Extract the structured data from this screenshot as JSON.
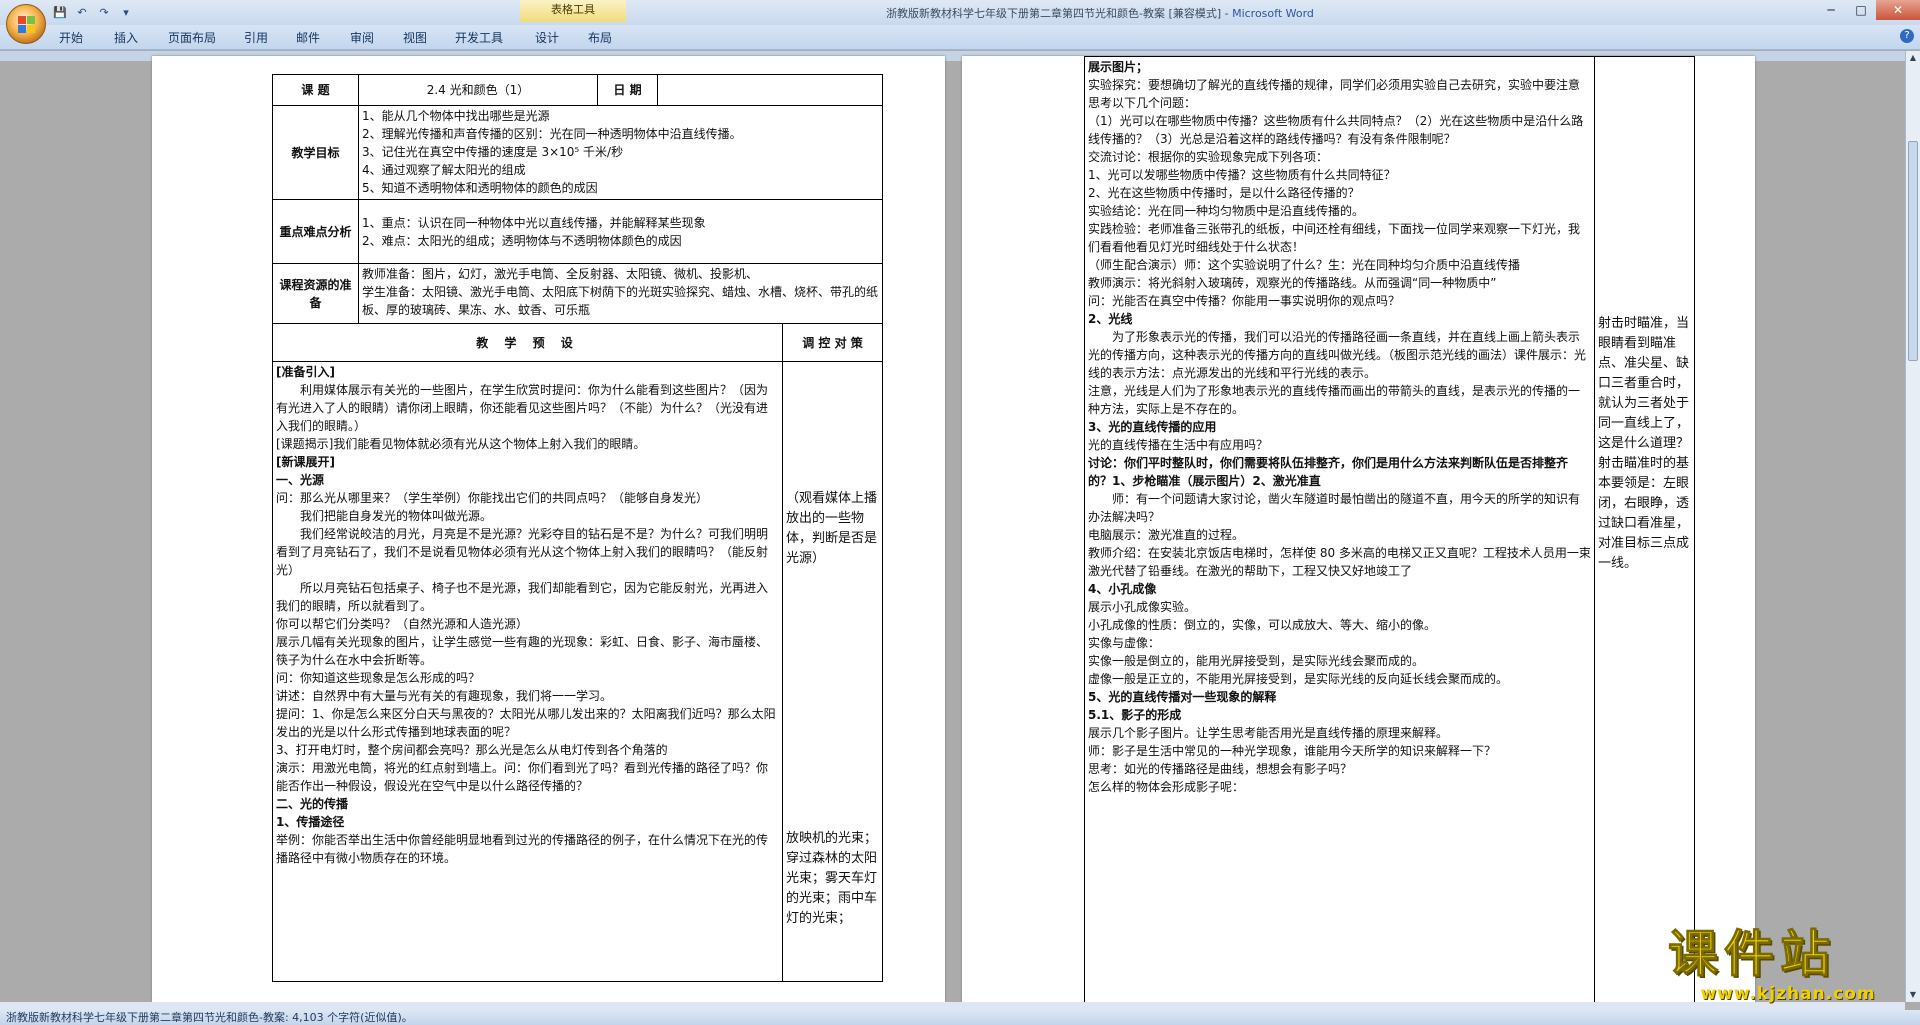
{
  "window": {
    "title_prefix": "浙教版新教材科学七年级下册第二章第四节光和颜色-教案 [兼容模式] - ",
    "app_name": "Microsoft Word",
    "table_tools": "表格工具"
  },
  "ribbon": {
    "tabs": [
      "开始",
      "插入",
      "页面布局",
      "引用",
      "邮件",
      "审阅",
      "视图",
      "开发工具",
      "设计",
      "布局"
    ]
  },
  "status": {
    "text": "浙教版新教材科学七年级下册第二章第四节光和颜色-教案: 4,103 个字符(近似值)。"
  },
  "watermark": {
    "text": "课件站",
    "url": "www.kjzhan.com"
  },
  "page1": {
    "topic_label": "课  题",
    "topic_value": "2.4 光和颜色（1）",
    "date_label": "日  期",
    "goals_label": "教学目标",
    "goals": [
      "1、能从几个物体中找出哪些是光源",
      "2、理解光传播和声音传播的区别：光在同一种透明物体中沿直线传播。",
      "3、记住光在真空中传播的速度是 3×10⁵ 千米/秒",
      "4、通过观察了解太阳光的组成",
      "5、知道不透明物体和透明物体的颜色的成因"
    ],
    "key_label": "重点难点分析",
    "key": [
      "1、重点：认识在同一种物体中光以直线传播，并能解释某些现象",
      "2、难点：太阳光的组成；透明物体与不透明物体颜色的成因"
    ],
    "res_label": "课程资源的准备",
    "res": [
      "教师准备：图片，幻灯，激光手电筒、全反射器、太阳镜、微机、投影机、",
      "学生准备：太阳镜、激光手电筒、太阳底下树荫下的光斑实验探究、蜡烛、水槽、烧杯、带孔的纸板、厚的玻璃砖、果冻、水、蚊香、可乐瓶"
    ],
    "plan_header": "教  学  预  设",
    "ctrl_header": "调 控 对 策",
    "body": [
      {
        "t": "[准备引入]",
        "b": true
      },
      {
        "t": "利用媒体展示有关光的一些图片，在学生欣赏时提问：你为什么能看到这些图片？（因为有光进入了人的眼睛）请你闭上眼睛，你还能看见这些图片吗？（不能）为什么？（光没有进入我们的眼睛。）",
        "i": true
      },
      {
        "t": " [课题揭示]我们能看见物体就必须有光从这个物体上射入我们的眼睛。"
      },
      {
        "t": " [新课展开]",
        "b": true
      },
      {
        "t": "一、光源",
        "b": true
      },
      {
        "t": "问：那么光从哪里来？（学生举例）你能找出它们的共同点吗？（能够自身发光）"
      },
      {
        "t": "我们把能自身发光的物体叫做光源。",
        "i": true
      },
      {
        "t": "我们经常说皎洁的月光，月亮是不是光源？光彩夺目的钻石是不是？为什么？可我们明明看到了月亮钻石了，我们不是说看见物体必须有光从这个物体上射入我们的眼睛吗？（能反射光）",
        "i": true
      },
      {
        "t": "所以月亮钻石包括桌子、椅子也不是光源，我们却能看到它，因为它能反射光，光再进入我们的眼睛，所以就看到了。",
        "i": true
      },
      {
        "t": "你可以帮它们分类吗？（自然光源和人造光源）"
      },
      {
        "t": "展示几幅有关光现象的图片，让学生感觉一些有趣的光现象：彩虹、日食、影子、海市蜃楼、筷子为什么在水中会折断等。"
      },
      {
        "t": "问：你知道这些现象是怎么形成的吗？"
      },
      {
        "t": "讲述：自然界中有大量与光有关的有趣现象，我们将一一学习。"
      },
      {
        "t": "提问：1、你是怎么来区分白天与黑夜的？太阳光从哪儿发出来的？太阳离我们近吗？那么太阳发出的光是以什么形式传播到地球表面的呢？"
      },
      {
        "t": "3、打开电灯时，整个房间都会亮吗？那么光是怎么从电灯传到各个角落的"
      },
      {
        "t": "演示：用激光电筒，将光的红点射到墙上。问：你们看到光了吗？看到光传播的路径了吗？你能否作出一种假设，假设光在空气中是以什么路径传播的？"
      },
      {
        "t": "二、光的传播",
        "b": true
      },
      {
        "t": "1、传播途径",
        "b": true
      },
      {
        "t": "举例：你能否举出生活中你曾经能明显地看到过光的传播路径的例子，在什么情况下在光的传播路径中有微小物质存在的环境。"
      }
    ],
    "ctrl_a": "（观看媒体上播放出的一些物体，判断是否是光源）",
    "ctrl_b": "放映机的光束；穿过森林的太阳光束；雾天车灯的光束；雨中车灯的光束；"
  },
  "page2": {
    "body": [
      {
        "t": "展示图片；",
        "b": true
      },
      {
        "t": "实验探究：要想确切了解光的直线传播的规律，同学们必须用实验自己去研究，实验中要注意思考以下几个问题："
      },
      {
        "t": "（1）光可以在哪些物质中传播？这些物质有什么共同特点？（2）光在这些物质中是沿什么路线传播的？（3）光总是沿着这样的路线传播吗？有没有条件限制呢？"
      },
      {
        "t": "交流讨论：根据你的实验现象完成下列各项："
      },
      {
        "t": "1、光可以发哪些物质中传播？这些物质有什么共同特征？"
      },
      {
        "t": "2、光在这些物质中传播时，是以什么路径传播的？"
      },
      {
        "t": "实验结论：光在同一种均匀物质中是沿直线传播的。"
      },
      {
        "t": "实践检验：老师准备三张带孔的纸板，中间还栓有细线，下面找一位同学来观察一下灯光，我们看看他看见灯光时细线处于什么状态！"
      },
      {
        "t": "（师生配合演示）师：这个实验说明了什么？生：光在同种均匀介质中沿直线传播"
      },
      {
        "t": "教师演示：将光斜射入玻璃砖，观察光的传播路线。从而强调“同一种物质中”"
      },
      {
        "t": "问：光能否在真空中传播？你能用一事实说明你的观点吗？"
      },
      {
        "t": "2、光线",
        "b": true
      },
      {
        "t": "为了形象表示光的传播，我们可以沿光的传播路径画一条直线，并在直线上画上箭头表示光的传播方向，这种表示光的传播方向的直线叫做光线。（板图示范光线的画法）课件展示：光线的表示方法：点光源发出的光线和平行光线的表示。",
        "i": true
      },
      {
        "t": "注意，光线是人们为了形象地表示光的直线传播而画出的带箭头的直线，是表示光的传播的一种方法，实际上是不存在的。"
      },
      {
        "t": "3、光的直线传播的应用",
        "b": true
      },
      {
        "t": "光的直线传播在生活中有应用吗？"
      },
      {
        "t": "讨论：你们平时整队时，你们需要将队伍排整齐，你们是用什么方法来判断队伍是否排整齐的？1、步枪瞄准（展示图片）2、激光准直",
        "b": true
      },
      {
        "t": "师：有一个问题请大家讨论，凿火车隧道时最怕凿出的隧道不直，用今天的所学的知识有办法解决吗？",
        "i": true
      },
      {
        "t": "电脑展示：激光准直的过程。"
      },
      {
        "t": "教师介绍：在安装北京饭店电梯时，怎样使 80 多米高的电梯又正又直呢？工程技术人员用一束激光代替了铅垂线。在激光的帮助下，工程又快又好地竣工了"
      },
      {
        "t": "4、小孔成像",
        "b": true
      },
      {
        "t": "展示小孔成像实验。"
      },
      {
        "t": "小孔成像的性质：倒立的，实像，可以成放大、等大、缩小的像。"
      },
      {
        "t": "实像与虚像："
      },
      {
        "t": "实像一般是倒立的，能用光屏接受到，是实际光线会聚而成的。"
      },
      {
        "t": "虚像一般是正立的，不能用光屏接受到，是实际光线的反向延长线会聚而成的。"
      },
      {
        "t": "5、光的直线传播对一些现象的解释",
        "b": true
      },
      {
        "t": "5.1、影子的形成",
        "b": true
      },
      {
        "t": "展示几个影子图片。让学生思考能否用光是直线传播的原理来解释。"
      },
      {
        "t": "师：影子是生活中常见的一种光学现象，谁能用今天所学的知识来解释一下？"
      },
      {
        "t": "思考：如光的传播路径是曲线，想想会有影子吗？"
      },
      {
        "t": "怎么样的物体会形成影子呢："
      }
    ],
    "ctrl": "射击时瞄准，当眼睛看到瞄准点、准尖星、缺口三者重合时，就认为三者处于同一直线上了，这是什么道理？射击瞄准时的基本要领是：左眼闭，右眼睁，透过缺口看准星，对准目标三点成一线。"
  }
}
